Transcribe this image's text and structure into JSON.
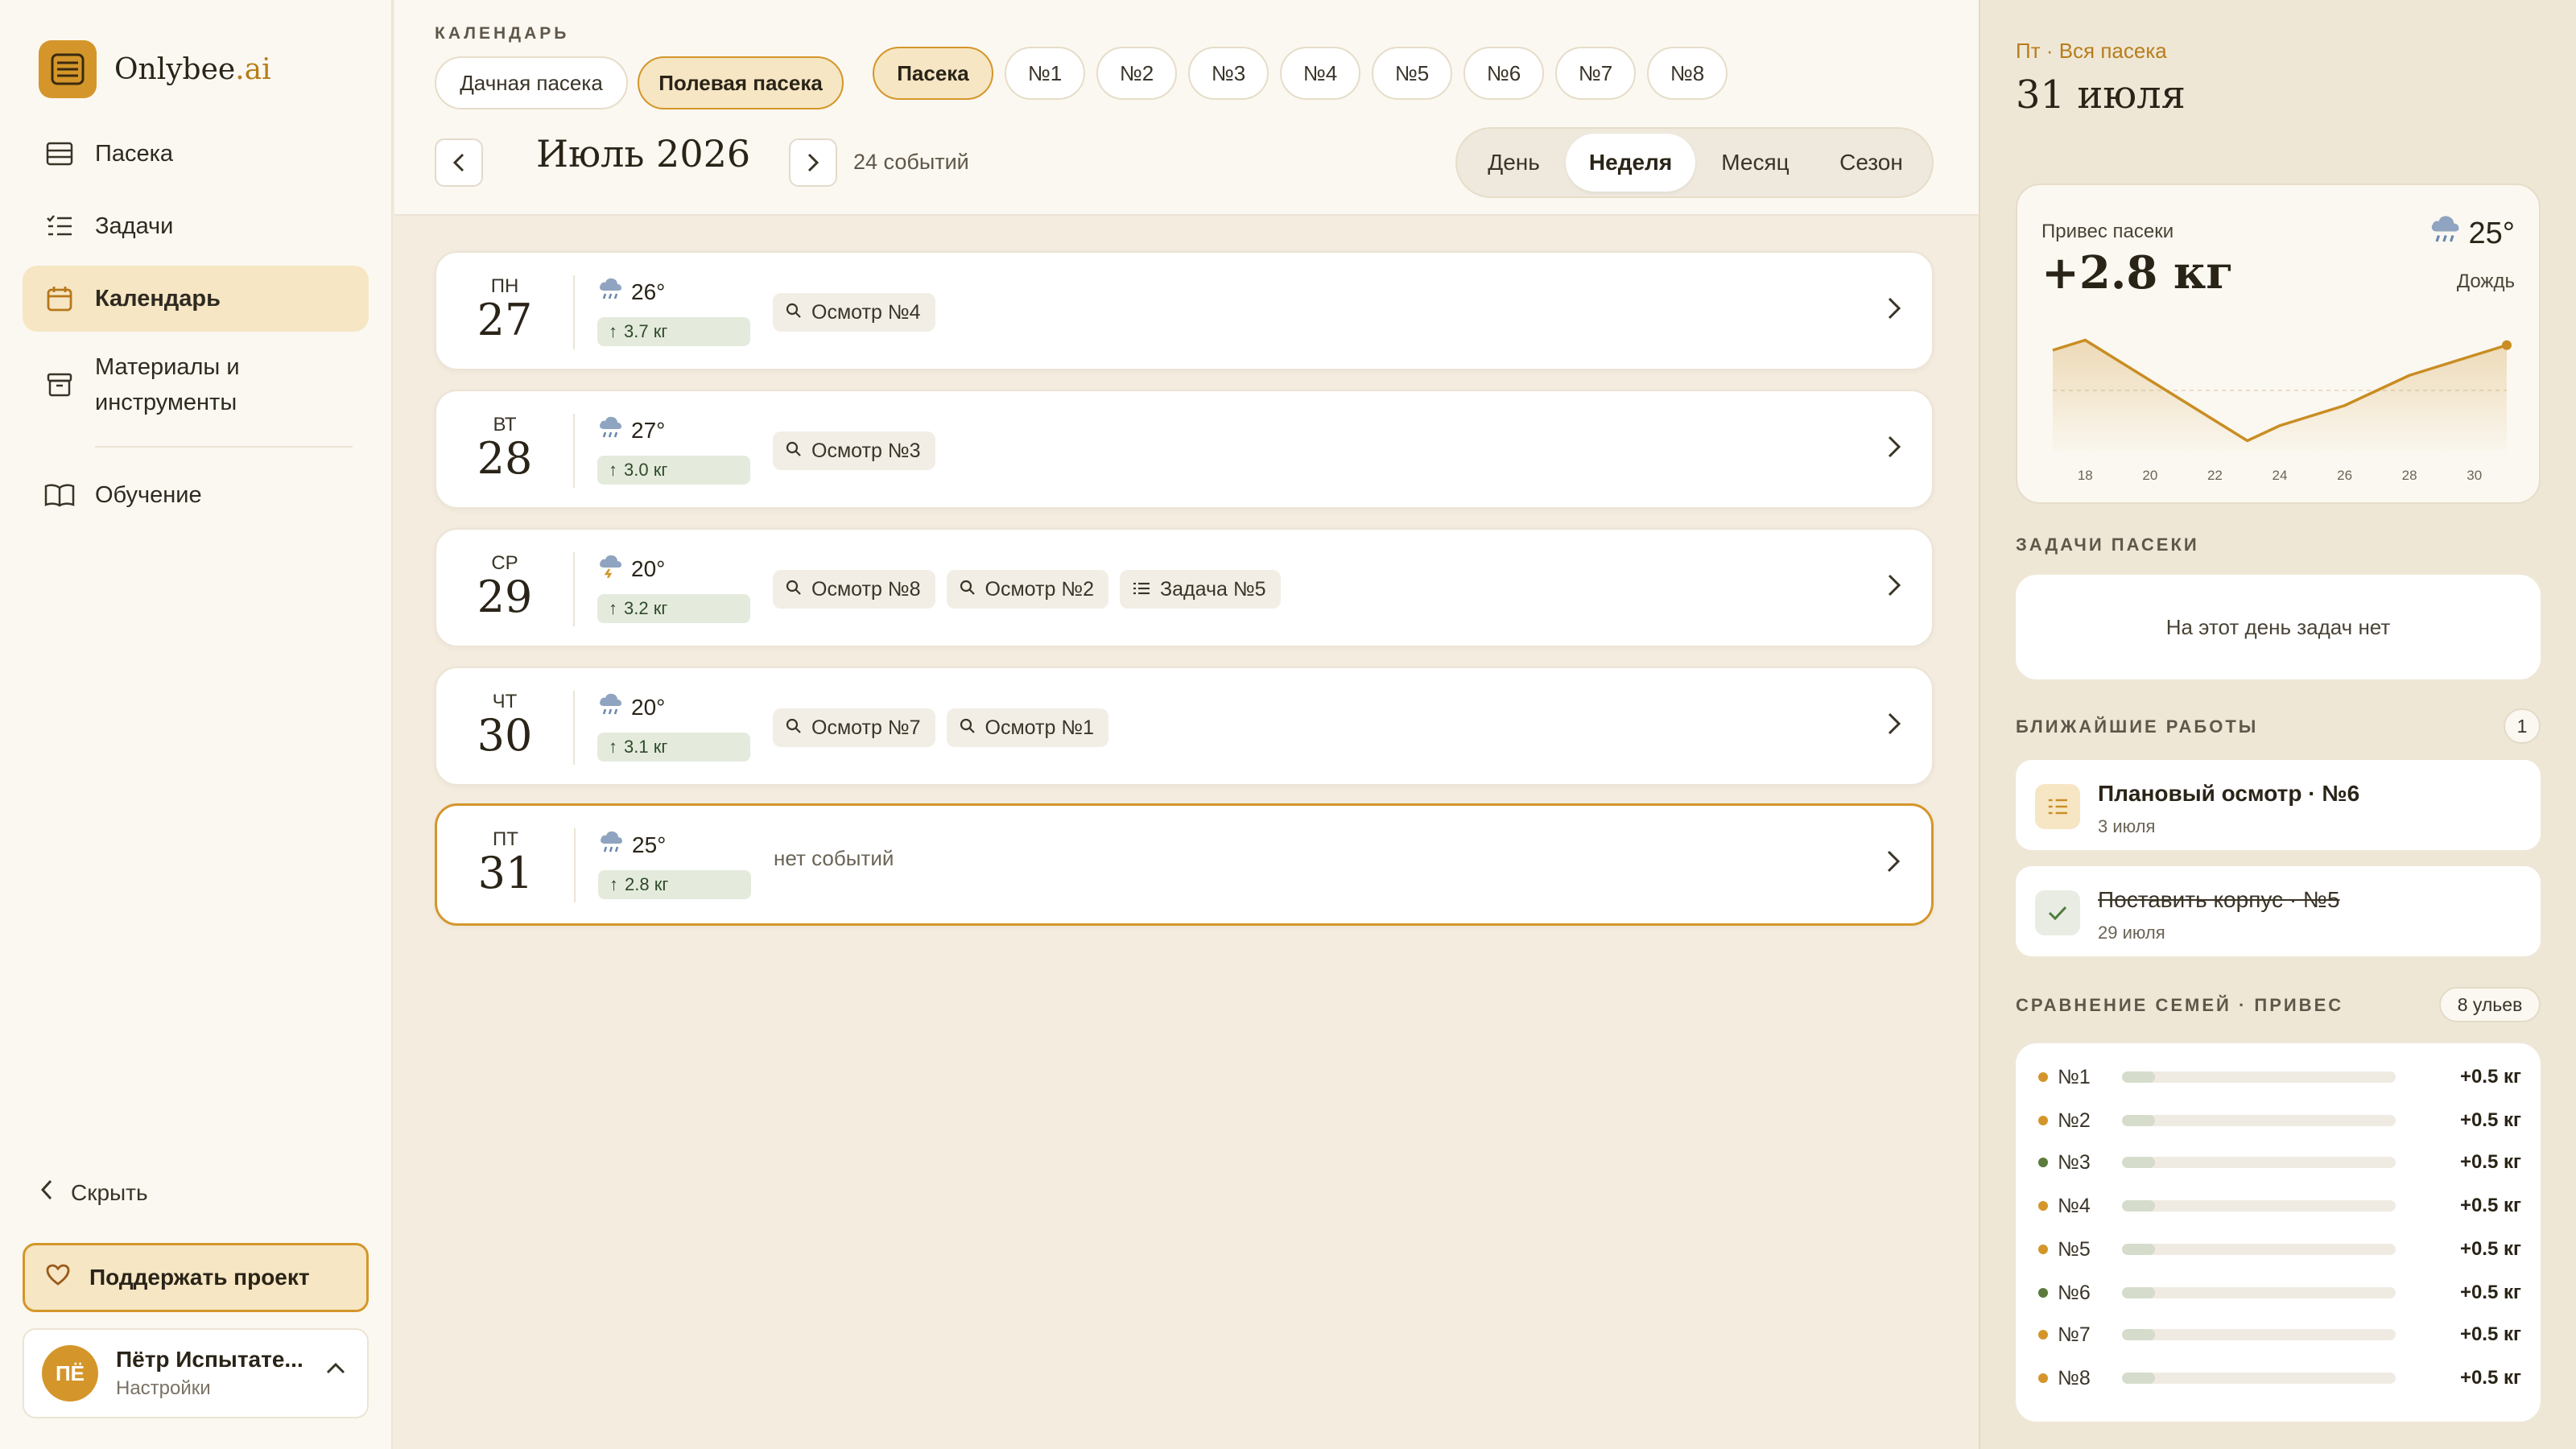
{
  "app": {
    "brand_main": "Onlybee",
    "brand_suffix": ".ai"
  },
  "sidebar": {
    "items": [
      {
        "label": "Пасека",
        "icon": "list-icon",
        "active": false
      },
      {
        "label": "Задачи",
        "icon": "checklist-icon",
        "active": false
      },
      {
        "label": "Календарь",
        "icon": "calendar-icon",
        "active": true
      },
      {
        "label": "Материалы и\nинструменты",
        "icon": "box-icon",
        "active": false
      },
      {
        "label": "Обучение",
        "icon": "book-icon",
        "active": false
      }
    ],
    "hide_label": "Скрыть",
    "support_label": "Поддержать проект",
    "user": {
      "initials": "ПЁ",
      "name": "Пётр Испытате...",
      "sub": "Настройки"
    }
  },
  "header": {
    "section_label": "КАЛЕНДАРЬ",
    "apiaries": [
      {
        "label": "Дачная пасека",
        "selected": false
      },
      {
        "label": "Полевая пасека",
        "selected": true
      }
    ],
    "hives": [
      {
        "label": "Пасека",
        "selected": true
      },
      {
        "label": "№1",
        "selected": false
      },
      {
        "label": "№2",
        "selected": false
      },
      {
        "label": "№3",
        "selected": false
      },
      {
        "label": "№4",
        "selected": false
      },
      {
        "label": "№5",
        "selected": false
      },
      {
        "label": "№6",
        "selected": false
      },
      {
        "label": "№7",
        "selected": false
      },
      {
        "label": "№8",
        "selected": false
      }
    ],
    "month": "Июль 2026",
    "event_count": "24 событий",
    "views": [
      {
        "label": "День",
        "active": false
      },
      {
        "label": "Неделя",
        "active": true
      },
      {
        "label": "Месяц",
        "active": false
      },
      {
        "label": "Сезон",
        "active": false
      }
    ]
  },
  "days": [
    {
      "abbr": "ПН",
      "num": "27",
      "temp": "26°",
      "gain": "3.7 кг",
      "weather_icon": "rain-cloud-icon",
      "today": false,
      "events": [
        {
          "label": "Осмотр №4",
          "icon": "search-icon"
        }
      ],
      "no_events": ""
    },
    {
      "abbr": "ВТ",
      "num": "28",
      "temp": "27°",
      "gain": "3.0 кг",
      "weather_icon": "rain-cloud-icon",
      "today": false,
      "events": [
        {
          "label": "Осмотр №3",
          "icon": "search-icon"
        }
      ],
      "no_events": ""
    },
    {
      "abbr": "СР",
      "num": "29",
      "temp": "20°",
      "gain": "3.2 кг",
      "weather_icon": "storm-cloud-icon",
      "today": false,
      "events": [
        {
          "label": "Осмотр №8",
          "icon": "search-icon"
        },
        {
          "label": "Осмотр №2",
          "icon": "search-icon"
        },
        {
          "label": "Задача №5",
          "icon": "list-icon"
        }
      ],
      "no_events": ""
    },
    {
      "abbr": "ЧТ",
      "num": "30",
      "temp": "20°",
      "gain": "3.1 кг",
      "weather_icon": "rain-cloud-icon",
      "today": false,
      "events": [
        {
          "label": "Осмотр №7",
          "icon": "search-icon"
        },
        {
          "label": "Осмотр №1",
          "icon": "search-icon"
        }
      ],
      "no_events": ""
    },
    {
      "abbr": "ПТ",
      "num": "31",
      "temp": "25°",
      "gain": "2.8 кг",
      "weather_icon": "rain-cloud-icon",
      "today": true,
      "events": [],
      "no_events": "нет событий"
    }
  ],
  "right": {
    "subtitle": "Пт · Вся пасека",
    "title": "31 июля",
    "weight": {
      "label": "Привес пасеки",
      "value": "+2.8 кг",
      "temp": "25°",
      "condition": "Дождь",
      "accent": "#c98d22"
    },
    "tasks_heading": "ЗАДАЧИ ПАСЕКИ",
    "tasks_empty": "На этот день задач нет",
    "upcoming_heading": "БЛИЖАЙШИЕ РАБОТЫ",
    "upcoming_count": "1",
    "upcoming": [
      {
        "title": "Плановый осмотр · №6",
        "date": "3 июля",
        "done": false,
        "icon": "checklist-icon"
      },
      {
        "title": "Поставить корпус · №5",
        "date": "29 июля",
        "done": true,
        "icon": "check-icon"
      }
    ],
    "compare_heading": "СРАВНЕНИЕ СЕМЕЙ · ПРИВЕС",
    "compare_count": "8 ульев",
    "compare": [
      {
        "name": "№1",
        "value": "+0.5 кг",
        "color": "#d4962a",
        "fraction": 0.12
      },
      {
        "name": "№2",
        "value": "+0.5 кг",
        "color": "#d4962a",
        "fraction": 0.12
      },
      {
        "name": "№3",
        "value": "+0.5 кг",
        "color": "#5b7a3c",
        "fraction": 0.12
      },
      {
        "name": "№4",
        "value": "+0.5 кг",
        "color": "#d4962a",
        "fraction": 0.12
      },
      {
        "name": "№5",
        "value": "+0.5 кг",
        "color": "#d4962a",
        "fraction": 0.12
      },
      {
        "name": "№6",
        "value": "+0.5 кг",
        "color": "#5b7a3c",
        "fraction": 0.12
      },
      {
        "name": "№7",
        "value": "+0.5 кг",
        "color": "#d4962a",
        "fraction": 0.12
      },
      {
        "name": "№8",
        "value": "+0.5 кг",
        "color": "#d4962a",
        "fraction": 0.12
      }
    ]
  },
  "chart_data": {
    "type": "area",
    "x": [
      17,
      18,
      19,
      20,
      21,
      22,
      23,
      24,
      25,
      26,
      27,
      28,
      29,
      30,
      31
    ],
    "values": [
      3.6,
      3.7,
      3.5,
      3.3,
      3.1,
      2.9,
      2.7,
      2.85,
      2.95,
      3.05,
      3.2,
      3.35,
      3.45,
      3.55,
      3.65
    ],
    "tick_labels": [
      "18",
      "20",
      "22",
      "24",
      "26",
      "28",
      "30"
    ],
    "ylim": [
      2.6,
      3.8
    ],
    "color": "#c98d22"
  }
}
